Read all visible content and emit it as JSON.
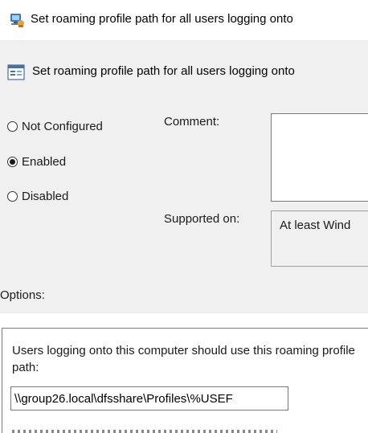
{
  "window": {
    "title": "Set roaming profile path for all users logging onto",
    "icon": "group-policy-icon"
  },
  "policy": {
    "name": "Set roaming profile path for all users logging onto",
    "icon": "policy-setting-icon"
  },
  "state_options": [
    {
      "label": "Not Configured",
      "checked": false
    },
    {
      "label": "Enabled",
      "checked": true
    },
    {
      "label": "Disabled",
      "checked": false
    }
  ],
  "comment": {
    "label": "Comment:",
    "value": ""
  },
  "supported_on": {
    "label": "Supported on:",
    "value": "At least Wind"
  },
  "options": {
    "label": "Options:",
    "description": "Users logging onto this computer should use this roaming profile path:",
    "path_value": "\\\\group26.local\\dfsshare\\Profiles\\%USEF"
  }
}
